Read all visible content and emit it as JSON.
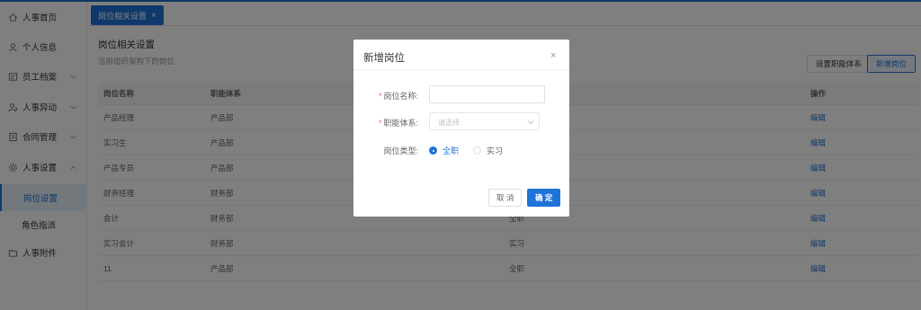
{
  "sidebar": {
    "items": [
      {
        "label": "人事首页",
        "icon": "home-icon"
      },
      {
        "label": "个人信息",
        "icon": "user-icon"
      },
      {
        "label": "员工档案",
        "icon": "archive-icon"
      },
      {
        "label": "人事异动",
        "icon": "user-transfer-icon"
      },
      {
        "label": "合同管理",
        "icon": "contract-icon"
      },
      {
        "label": "人事设置",
        "icon": "gear-icon"
      },
      {
        "label": "人事附件",
        "icon": "folder-icon"
      }
    ],
    "sub_items": [
      {
        "label": "岗位设置",
        "active": true
      },
      {
        "label": "角色指派",
        "active": false
      }
    ]
  },
  "tabs": [
    {
      "label": "岗位相关设置",
      "close": "×"
    }
  ],
  "page": {
    "title": "岗位相关设置",
    "subtitle": "当前组织架构下的岗位",
    "set_system_button": "设置职能体系",
    "add_position_button": "新增岗位"
  },
  "table": {
    "headers": [
      "岗位名称",
      "职能体系",
      "",
      "操作"
    ],
    "rows": [
      {
        "name": "产品经理",
        "system": "产品部",
        "type": "",
        "action": "编辑"
      },
      {
        "name": "实习生",
        "system": "产品部",
        "type": "",
        "action": "编辑"
      },
      {
        "name": "产品专员",
        "system": "产品部",
        "type": "",
        "action": "编辑"
      },
      {
        "name": "财务经理",
        "system": "财务部",
        "type": "",
        "action": "编辑"
      },
      {
        "name": "会计",
        "system": "财务部",
        "type": "全职",
        "action": "编辑"
      },
      {
        "name": "实习会计",
        "system": "财务部",
        "type": "实习",
        "action": "编辑"
      },
      {
        "name": "11",
        "system": "产品部",
        "type": "全职",
        "action": "编辑"
      }
    ]
  },
  "dialog": {
    "title": "新增岗位",
    "close": "×",
    "name_label": "岗位名称:",
    "system_label": "职能体系:",
    "system_placeholder": "请选择",
    "type_label": "岗位类型:",
    "required_mark": "*",
    "options": [
      {
        "label": "全职",
        "selected": true
      },
      {
        "label": "实习",
        "selected": false
      }
    ],
    "cancel": "取 消",
    "confirm": "确 定"
  },
  "colors": {
    "accent": "#1e73d8",
    "overlay": "rgba(0,0,0,0.5)"
  }
}
